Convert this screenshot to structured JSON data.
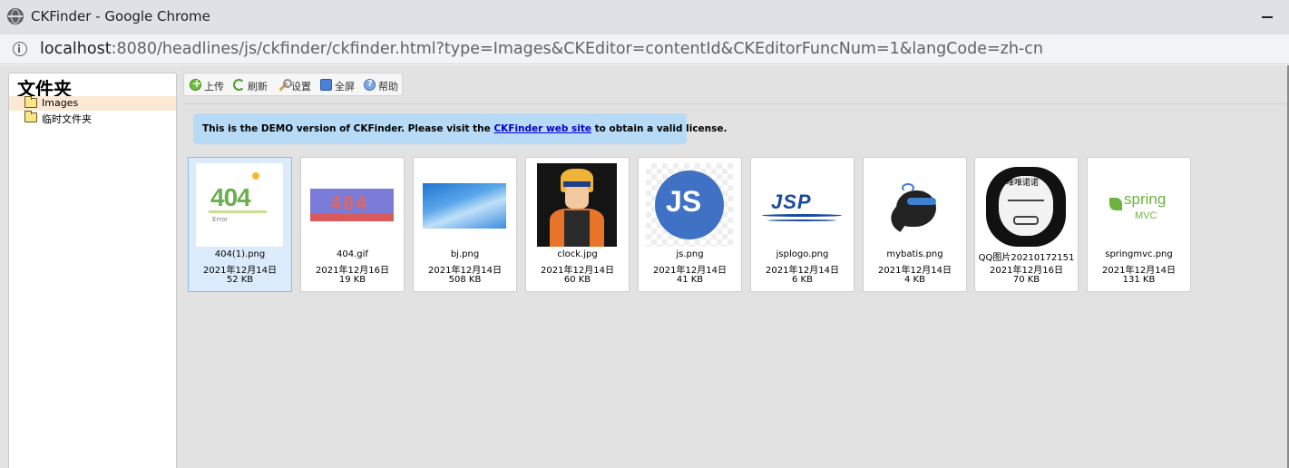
{
  "window": {
    "title": "CKFinder - Google Chrome",
    "url_host": "localhost",
    "url_rest": ":8080/headlines/js/ckfinder/ckfinder.html?type=Images&CKEditor=contentId&CKEditorFuncNum=1&langCode=zh-cn"
  },
  "sidebar": {
    "heading": "文件夹",
    "folders": [
      {
        "label": "Images",
        "selected": true
      },
      {
        "label": "临时文件夹",
        "selected": false
      }
    ]
  },
  "toolbar": {
    "upload": "上传",
    "refresh": "刷新",
    "settings": "设置",
    "fullscreen": "全屏",
    "help": "帮助"
  },
  "notice": {
    "before": "This is the DEMO version of CKFinder. Please visit the ",
    "link": "CKFinder web site",
    "after": " to obtain a valid license."
  },
  "files": [
    {
      "name": "404(1).png",
      "date": "2021年12月14日",
      "size": "52 KB",
      "selected": true,
      "thumb_text": "404",
      "thumb_sub": "Error"
    },
    {
      "name": "404.gif",
      "date": "2021年12月16日",
      "size": "19 KB",
      "selected": false,
      "thumb_text": "404"
    },
    {
      "name": "bj.png",
      "date": "2021年12月14日",
      "size": "508 KB",
      "selected": false
    },
    {
      "name": "clock.jpg",
      "date": "2021年12月14日",
      "size": "60 KB",
      "selected": false
    },
    {
      "name": "js.png",
      "date": "2021年12月14日",
      "size": "41 KB",
      "selected": false,
      "thumb_text": "JS"
    },
    {
      "name": "jsplogo.png",
      "date": "2021年12月14日",
      "size": "6 KB",
      "selected": false,
      "thumb_text": "JSP"
    },
    {
      "name": "mybatis.png",
      "date": "2021年12月14日",
      "size": "4 KB",
      "selected": false
    },
    {
      "name": "QQ图片20210172151",
      "date": "2021年12月16日",
      "size": "70 KB",
      "selected": false,
      "thumb_text": "唯唯诺诺"
    },
    {
      "name": "springmvc.png",
      "date": "2021年12月14日",
      "size": "131 KB",
      "selected": false,
      "thumb_text": "spring",
      "thumb_sub": "MVC"
    }
  ]
}
